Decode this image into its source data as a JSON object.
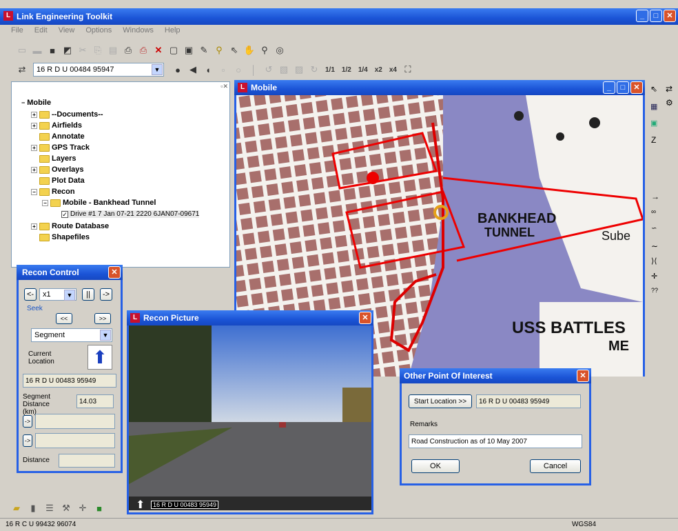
{
  "app": {
    "title": "Link Engineering Toolkit"
  },
  "menus": [
    "File",
    "Edit",
    "View",
    "Options",
    "Windows",
    "Help"
  ],
  "toolbar": {
    "location_value": "16 R D U 00484 95947",
    "zoom_labels": [
      "1/1",
      "1/2",
      "1/4",
      "x2",
      "x4"
    ]
  },
  "tree": {
    "root": "Mobile",
    "items": [
      "--Documents--",
      "Airfields",
      "Annotate",
      "GPS Track",
      "Layers",
      "Overlays",
      "Plot Data",
      "Recon",
      "Mobile - Bankhead Tunnel",
      "Drive #1 7 Jan 07-21 2220 6JAN07-09671",
      "Route Database",
      "Shapefiles"
    ]
  },
  "map_window": {
    "title": "Mobile",
    "labels": [
      "BANKHEAD",
      "TUNNEL",
      "USS BATTLES",
      "ME",
      "Sube"
    ]
  },
  "recon_control": {
    "title": "Recon Control",
    "speed": "x1",
    "seek_label": "Seek",
    "mode": "Segment",
    "current_location_label": "Current Location",
    "current_location": "16 R D U 00483 95949",
    "segment_distance_label": "Segment Distance (km)",
    "segment_distance": "14.03",
    "distance_label": "Distance"
  },
  "recon_picture": {
    "title": "Recon Picture",
    "overlay_coords": "16 R D U 00483 95949"
  },
  "poi_dialog": {
    "title": "Other Point Of Interest",
    "start_location_button": "Start Location >>",
    "start_location_value": "16 R D U 00483 95949",
    "remarks_label": "Remarks",
    "remarks_value": "Road Construction as of 10 May 2007",
    "ok_label": "OK",
    "cancel_label": "Cancel"
  },
  "statusbar": {
    "coords": "16 R C U 99432 96074",
    "datum": "WGS84"
  }
}
